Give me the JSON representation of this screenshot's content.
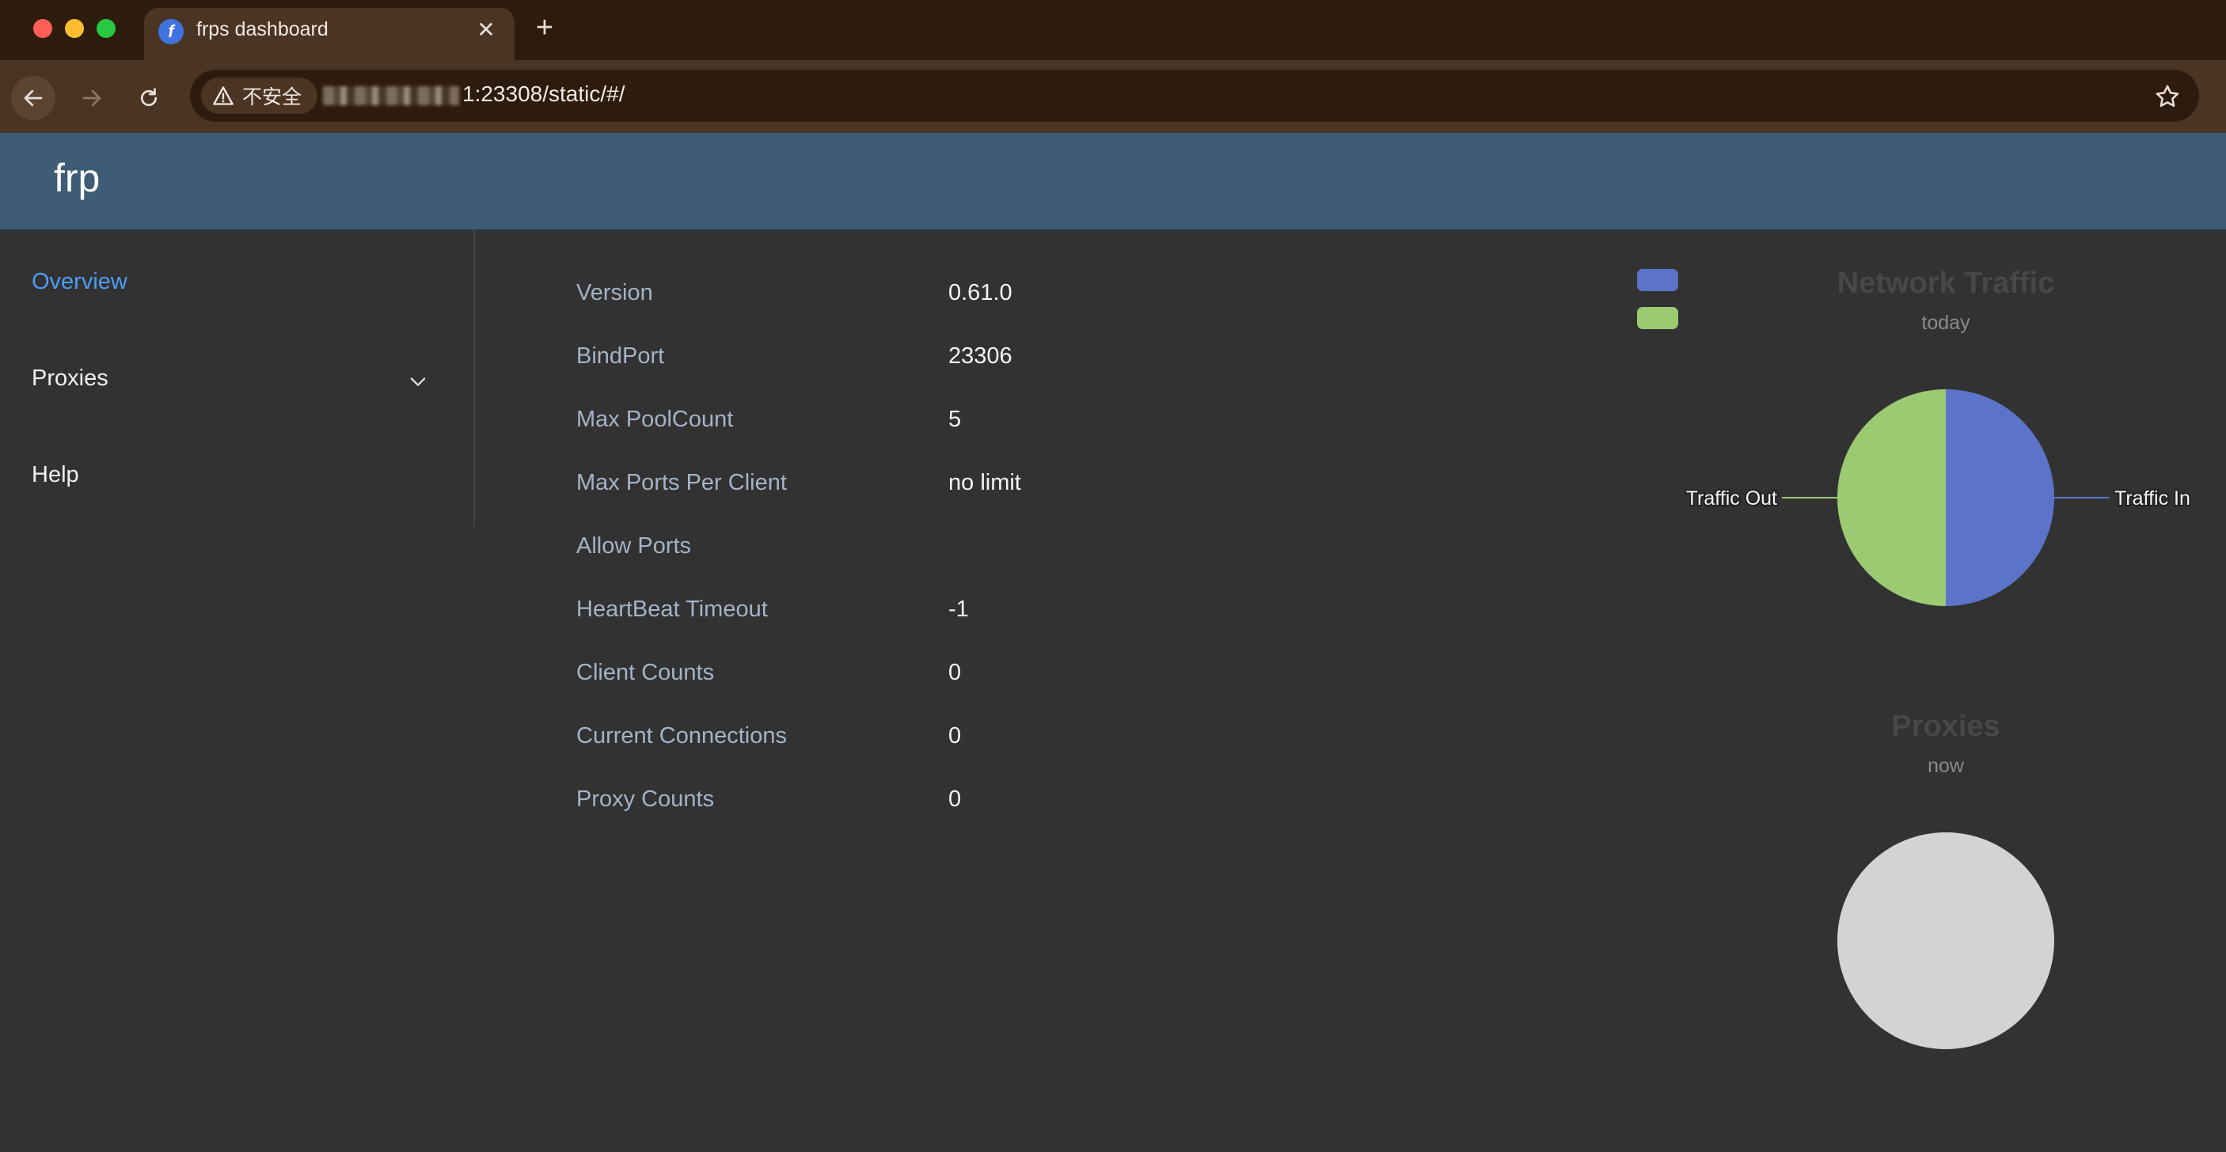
{
  "browser": {
    "tab_title": "frps dashboard",
    "tab_favicon": "frp-logo-icon",
    "security_label": "不安全",
    "url_visible": ":23308/static/#/",
    "url_prefix_digit": "1"
  },
  "app": {
    "brand": "frp",
    "accent_color": "#4e9cf5",
    "header_color": "#3e5c75"
  },
  "sidebar": {
    "items": [
      {
        "label": "Overview",
        "active": true
      },
      {
        "label": "Proxies",
        "active": false,
        "has_submenu": true
      },
      {
        "label": "Help",
        "active": false
      }
    ]
  },
  "overview": {
    "rows": [
      {
        "label": "Version",
        "value": "0.61.0"
      },
      {
        "label": "BindPort",
        "value": "23306"
      },
      {
        "label": "Max PoolCount",
        "value": "5"
      },
      {
        "label": "Max Ports Per Client",
        "value": "no limit"
      },
      {
        "label": "Allow Ports",
        "value": ""
      },
      {
        "label": "HeartBeat Timeout",
        "value": "-1"
      },
      {
        "label": "Client Counts",
        "value": "0"
      },
      {
        "label": "Current Connections",
        "value": "0"
      },
      {
        "label": "Proxy Counts",
        "value": "0"
      }
    ]
  },
  "chart_data": [
    {
      "type": "pie",
      "title": "Network Traffic",
      "subtitle": "today",
      "legend": "top-left",
      "slices": [
        {
          "label": "Traffic In",
          "value": 50,
          "color": "#5b73c9"
        },
        {
          "label": "Traffic Out",
          "value": 50,
          "color": "#9bca73"
        }
      ]
    },
    {
      "type": "pie",
      "title": "Proxies",
      "subtitle": "now",
      "slices": [],
      "empty_color": "#d3d3d3"
    }
  ]
}
